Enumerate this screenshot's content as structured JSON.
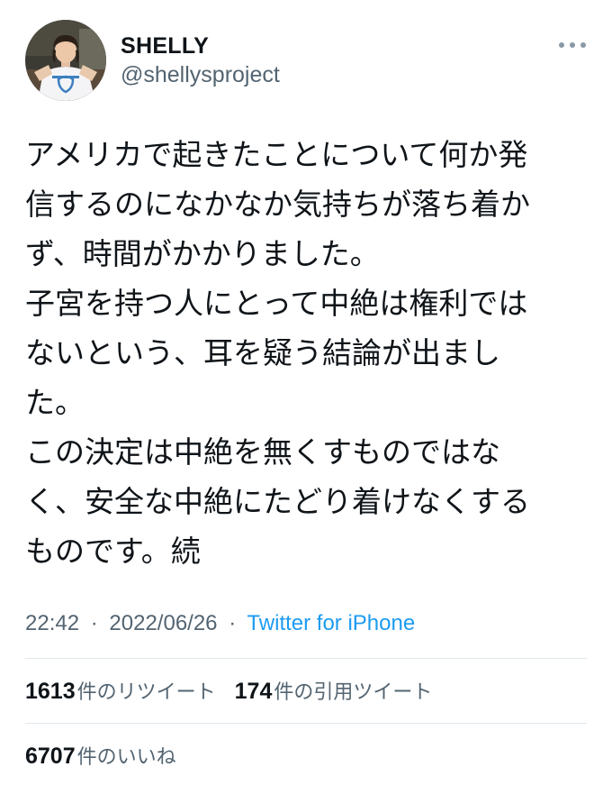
{
  "author": {
    "display_name": "SHELLY",
    "handle": "@shellysproject"
  },
  "tweet": {
    "lines": [
      "アメリカで起きたことについて何か発",
      "信するのになかなか気持ちが落ち着か",
      "ず、時間がかかりました。",
      "子宮を持つ人にとって中絶は権利では",
      "ないという、耳を疑う結論が出まし",
      "た。",
      "この決定は中絶を無くすものではな",
      "く、安全な中絶にたどり着けなくする",
      "ものです。続"
    ],
    "time": "22:42",
    "date": "2022/06/26",
    "separator": "·",
    "source": "Twitter for iPhone"
  },
  "stats": {
    "retweets": {
      "count": "1613",
      "label": "件のリツイート"
    },
    "quotes": {
      "count": "174",
      "label": "件の引用ツイート"
    },
    "likes": {
      "count": "6707",
      "label": "件のいいね"
    }
  },
  "icons": {
    "more": "more-horizontal-icon",
    "avatar": "profile-photo"
  },
  "colors": {
    "text": "#0f1419",
    "secondary": "#536471",
    "link": "#1d9bf0",
    "divider": "#e1e8ed"
  }
}
